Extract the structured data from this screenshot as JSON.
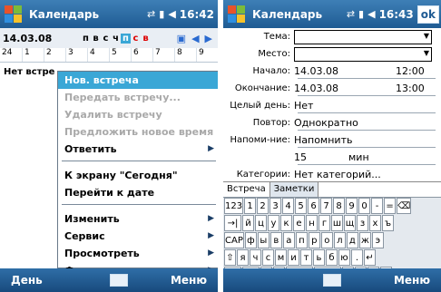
{
  "left": {
    "title": "Календарь",
    "clock": "16:42",
    "date": "14.03.08",
    "weekdays": [
      "п",
      "в",
      "с",
      "ч",
      "п",
      "с",
      "в"
    ],
    "hours": [
      "24",
      "1",
      "2",
      "3",
      "4",
      "5",
      "6",
      "7",
      "8",
      "9"
    ],
    "allday_text": "Нет встре",
    "menu": [
      {
        "label": "Нов. встреча",
        "state": "active",
        "submenu": false
      },
      {
        "label": "Передать встречу...",
        "state": "disabled",
        "submenu": false
      },
      {
        "label": "Удалить встречу",
        "state": "disabled",
        "submenu": false
      },
      {
        "label": "Предложить новое время",
        "state": "disabled",
        "submenu": false
      },
      {
        "label": "Ответить",
        "state": "normal",
        "submenu": true
      },
      {
        "sep": true
      },
      {
        "label": "К экрану \"Сегодня\"",
        "state": "normal",
        "submenu": false
      },
      {
        "label": "Перейти к дате",
        "state": "normal",
        "submenu": false
      },
      {
        "sep": true
      },
      {
        "label": "Изменить",
        "state": "normal",
        "submenu": true
      },
      {
        "label": "Сервис",
        "state": "normal",
        "submenu": true
      },
      {
        "label": "Просмотреть",
        "state": "normal",
        "submenu": true
      },
      {
        "label": "Фильтр",
        "state": "normal",
        "submenu": true
      }
    ],
    "softkey_left": "День",
    "softkey_right": "Меню"
  },
  "right": {
    "title": "Календарь",
    "clock": "16:43",
    "ok": "ok",
    "fields": [
      {
        "label": "Тема:",
        "value": "",
        "type": "combo"
      },
      {
        "label": "Место:",
        "value": "",
        "type": "combo"
      },
      {
        "label": "Начало:",
        "value": "14.03.08",
        "value2": "12:00"
      },
      {
        "label": "Окончание:",
        "value": "14.03.08",
        "value2": "13:00"
      },
      {
        "label": "Целый день:",
        "value": "Нет"
      },
      {
        "label": "Повтор:",
        "value": "Однократно"
      },
      {
        "label": "Напоми-ние:",
        "value": "Напомнить"
      },
      {
        "label": "",
        "value": "15",
        "value2": "мин"
      },
      {
        "label": "Категории:",
        "value": "Нет категорий..."
      }
    ],
    "tabs": [
      "Встреча",
      "Заметки"
    ],
    "keyboard": [
      [
        "123",
        "1",
        "2",
        "3",
        "4",
        "5",
        "6",
        "7",
        "8",
        "9",
        "0",
        "-",
        "=",
        "⌫"
      ],
      [
        "→|",
        "й",
        "ц",
        "у",
        "к",
        "е",
        "н",
        "г",
        "ш",
        "щ",
        "з",
        "х",
        "ъ"
      ],
      [
        "CAP",
        "ф",
        "ы",
        "в",
        "а",
        "п",
        "р",
        "о",
        "л",
        "д",
        "ж",
        "э"
      ],
      [
        "⇧",
        "я",
        "ч",
        "с",
        "м",
        "и",
        "т",
        "ь",
        "б",
        "ю",
        ".",
        "↵"
      ],
      [
        "Ctl",
        "au",
        "ё",
        "\\",
        "",
        "",
        "↓",
        "↑",
        "←",
        "→"
      ]
    ],
    "softkey_right": "Меню"
  }
}
